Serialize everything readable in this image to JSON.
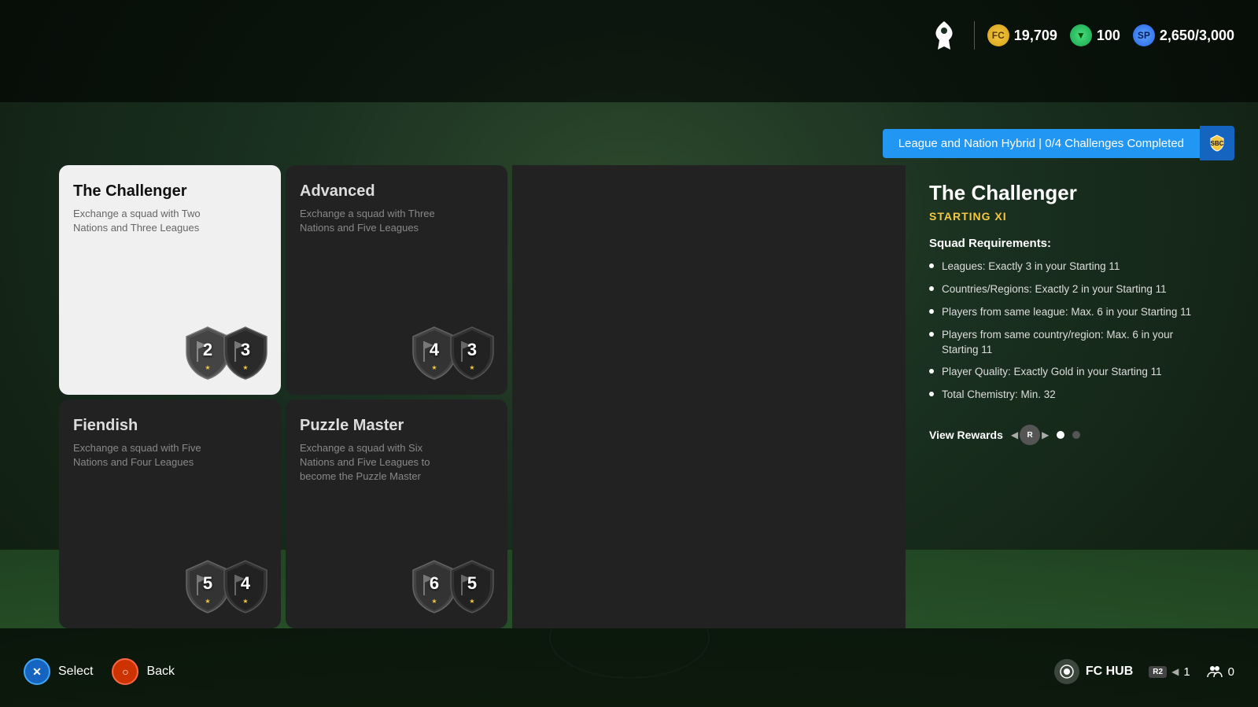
{
  "top_bar": {
    "coins": "19,709",
    "points": "100",
    "sp_current": "2,650",
    "sp_max": "3,000"
  },
  "challenge_banner": {
    "text": "League and Nation Hybrid | 0/4 Challenges Completed"
  },
  "cards": [
    {
      "id": "challenger",
      "title": "The Challenger",
      "description": "Exchange a squad with Two Nations and Three Leagues",
      "badge1": "2",
      "badge2": "3",
      "selected": true
    },
    {
      "id": "advanced",
      "title": "Advanced",
      "description": "Exchange a squad with Three Nations and Five Leagues",
      "badge1": "4",
      "badge2": "3",
      "selected": false
    },
    {
      "id": "fiendish",
      "title": "Fiendish",
      "description": "Exchange a squad with Five Nations and Four Leagues",
      "badge1": "5",
      "badge2": "4",
      "selected": false
    },
    {
      "id": "puzzle_master",
      "title": "Puzzle Master",
      "description": "Exchange a squad with Six Nations and Five Leagues to become the Puzzle Master",
      "badge1": "6",
      "badge2": "5",
      "selected": false
    }
  ],
  "detail_panel": {
    "title": "The Challenger",
    "subtitle": "STARTING XI",
    "requirements_heading": "Squad Requirements:",
    "requirements": [
      "Leagues: Exactly 3 in your Starting 11",
      "Countries/Regions: Exactly 2 in your Starting 11",
      "Players from same league: Max. 6 in your Starting 11",
      "Players from same country/region: Max. 6 in your Starting 11",
      "Player Quality: Exactly Gold in your Starting 11",
      "Total Chemistry: Min. 32"
    ],
    "view_rewards_label": "View Rewards"
  },
  "bottom_bar": {
    "select_label": "Select",
    "back_label": "Back",
    "fc_hub_label": "FC HUB",
    "count1": "1",
    "count2": "0"
  }
}
